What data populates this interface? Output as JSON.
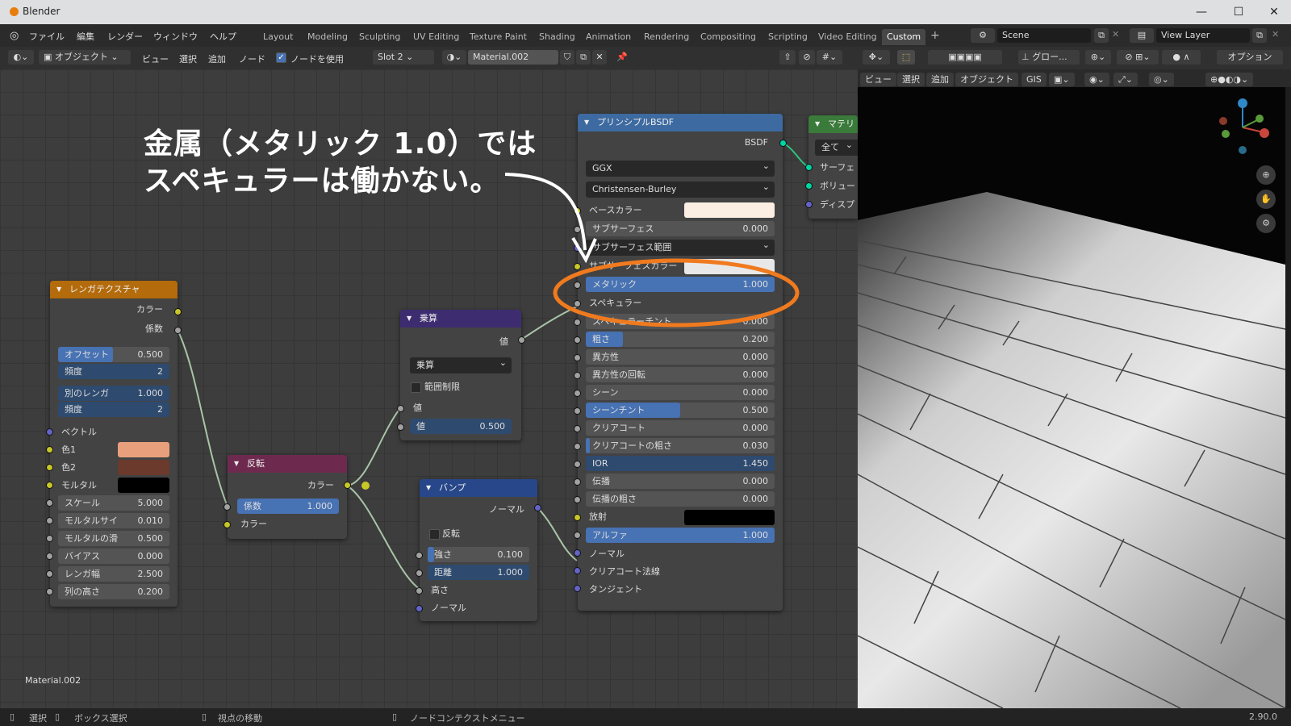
{
  "window": {
    "title": "Blender",
    "min": "—",
    "max": "☐",
    "close": "✕"
  },
  "menu": [
    "ファイル",
    "編集",
    "レンダー",
    "ウィンドウ",
    "ヘルプ"
  ],
  "workspaces": [
    "Layout",
    "Modeling",
    "Sculpting",
    "UV Editing",
    "Texture Paint",
    "Shading",
    "Animation",
    "Rendering",
    "Compositing",
    "Scripting",
    "Video Editing",
    "Custom"
  ],
  "scene": "Scene",
  "view_layer": "View Layer",
  "nodebar": {
    "mode": "オブジェクト",
    "view": "ビュー",
    "select": "選択",
    "add": "追加",
    "node": "ノード",
    "use_nodes": "ノードを使用",
    "slot": "Slot 2",
    "material": "Material.002"
  },
  "vpbar": {
    "glow": "グロー...",
    "options": "オプション",
    "view": "ビュー",
    "select": "選択",
    "add": "追加",
    "object": "オブジェクト",
    "gis": "GIS"
  },
  "annotation": {
    "line1": "金属（メタリック 1.0）では",
    "line2": "スペキュラーは働かない。"
  },
  "brick": {
    "title": "レンガテクスチャ",
    "out_color": "カラー",
    "out_fac": "係数",
    "offset": {
      "label": "オフセット",
      "value": "0.500"
    },
    "freq1": {
      "label": "頻度",
      "value": "2"
    },
    "squash": {
      "label": "別のレンガ",
      "value": "1.000"
    },
    "freq2": {
      "label": "頻度",
      "value": "2"
    },
    "vector": "ベクトル",
    "color1": "色1",
    "color2": "色2",
    "mortar": "モルタル",
    "scale": {
      "label": "スケール",
      "value": "5.000"
    },
    "mortar_size": {
      "label": "モルタルサイ",
      "value": "0.010"
    },
    "mortar_smooth": {
      "label": "モルタルの滑",
      "value": "0.500"
    },
    "bias": {
      "label": "バイアス",
      "value": "0.000"
    },
    "brick_width": {
      "label": "レンガ幅",
      "value": "2.500"
    },
    "row_height": {
      "label": "列の高さ",
      "value": "0.200"
    },
    "color1_hex": "#e8a07c",
    "color2_hex": "#6b3a2c",
    "mortar_hex": "#000000"
  },
  "invert": {
    "title": "反転",
    "out": "カラー",
    "fac": {
      "label": "係数",
      "value": "1.000"
    },
    "in": "カラー"
  },
  "multiply": {
    "title": "乗算",
    "out": "値",
    "op": "乗算",
    "clamp": "範囲制限",
    "in": "値",
    "val": {
      "label": "値",
      "value": "0.500"
    }
  },
  "bump": {
    "title": "バンプ",
    "out": "ノーマル",
    "invert": "反転",
    "strength": {
      "label": "強さ",
      "value": "0.100"
    },
    "distance": {
      "label": "距離",
      "value": "1.000"
    },
    "height": "高さ",
    "normal": "ノーマル"
  },
  "bsdf": {
    "title": "プリンシプルBSDF",
    "out": "BSDF",
    "dist": "GGX",
    "sss_method": "Christensen-Burley",
    "base_color": "ベースカラー",
    "subsurface": {
      "label": "サブサーフェス",
      "value": "0.000"
    },
    "sss_radius": "サブサーフェス範囲",
    "sss_color": "サブサーフェスカラー",
    "metallic": {
      "label": "メタリック",
      "value": "1.000"
    },
    "specular": "スペキュラー",
    "specular_tint": {
      "label": "スペキュラーチント",
      "value": "0.000"
    },
    "roughness": {
      "label": "粗さ",
      "value": "0.200"
    },
    "anisotropic": {
      "label": "異方性",
      "value": "0.000"
    },
    "aniso_rot": {
      "label": "異方性の回転",
      "value": "0.000"
    },
    "sheen": {
      "label": "シーン",
      "value": "0.000"
    },
    "sheen_tint": {
      "label": "シーンチント",
      "value": "0.500"
    },
    "clearcoat": {
      "label": "クリアコート",
      "value": "0.000"
    },
    "cc_rough": {
      "label": "クリアコートの粗さ",
      "value": "0.030"
    },
    "ior": {
      "label": "IOR",
      "value": "1.450"
    },
    "transmission": {
      "label": "伝播",
      "value": "0.000"
    },
    "trans_rough": {
      "label": "伝播の粗さ",
      "value": "0.000"
    },
    "emission": "放射",
    "alpha": {
      "label": "アルファ",
      "value": "1.000"
    },
    "normal": "ノーマル",
    "cc_normal": "クリアコート法線",
    "tangent": "タンジェント"
  },
  "matout": {
    "title": "マテリ",
    "target": "全て",
    "surface": "サーフェ",
    "volume": "ボリュー",
    "disp": "ディスプ"
  },
  "editor_label": "Material.002",
  "status": {
    "select": "選択",
    "box": "ボックス選択",
    "pan": "視点の移動",
    "ctx": "ノードコンテクストメニュー",
    "version": "2.90.0"
  }
}
